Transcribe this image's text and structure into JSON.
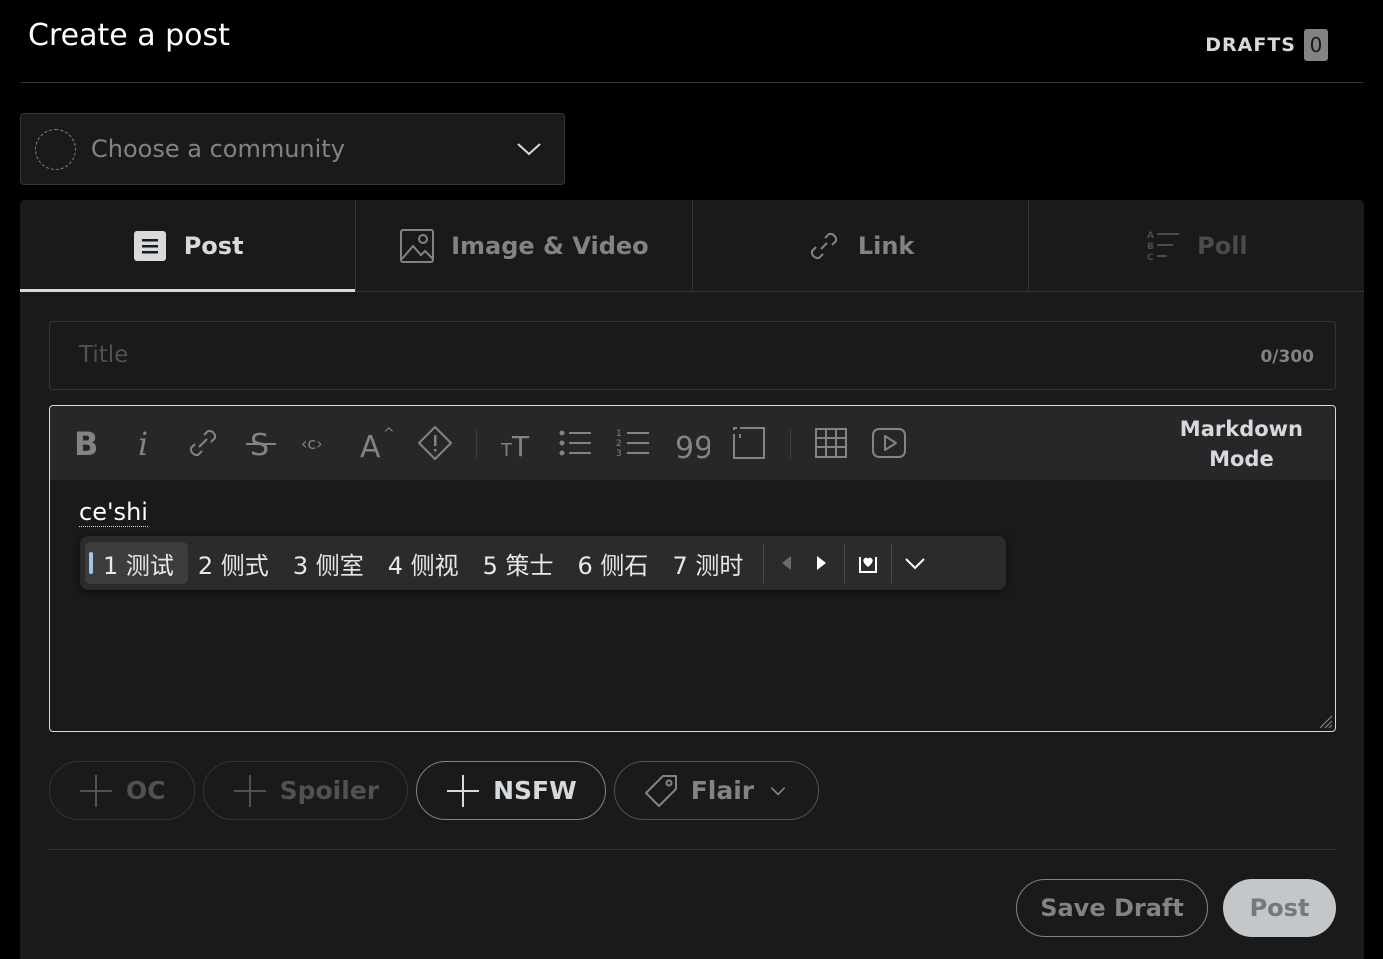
{
  "header": {
    "title": "Create a post",
    "drafts_label": "DRAFTS",
    "drafts_count": "0"
  },
  "community": {
    "placeholder": "Choose a community"
  },
  "tabs": [
    {
      "label": "Post",
      "icon": "post-icon"
    },
    {
      "label": "Image & Video",
      "icon": "image-icon"
    },
    {
      "label": "Link",
      "icon": "link-icon"
    },
    {
      "label": "Poll",
      "icon": "poll-icon"
    }
  ],
  "title_field": {
    "placeholder": "Title",
    "counter": "0/300"
  },
  "toolbar": {
    "icons": [
      "bold-icon",
      "italic-icon",
      "link-icon",
      "strikethrough-icon",
      "inline-code-icon",
      "superscript-icon",
      "spoiler-icon",
      "heading-icon",
      "bulleted-list-icon",
      "numbered-list-icon",
      "quote-block-icon",
      "code-block-icon",
      "table-icon",
      "video-icon"
    ],
    "markdown_mode_line1": "Markdown",
    "markdown_mode_line2": "Mode"
  },
  "editor": {
    "text": "ce'shi"
  },
  "ime": {
    "candidates": [
      "1 测试",
      "2 侧式",
      "3 侧室",
      "4 侧视",
      "5 策士",
      "6 侧石",
      "7 测时"
    ]
  },
  "chips": {
    "oc": "OC",
    "spoiler": "Spoiler",
    "nsfw": "NSFW",
    "flair": "Flair"
  },
  "actions": {
    "save_draft": "Save Draft",
    "post": "Post"
  }
}
